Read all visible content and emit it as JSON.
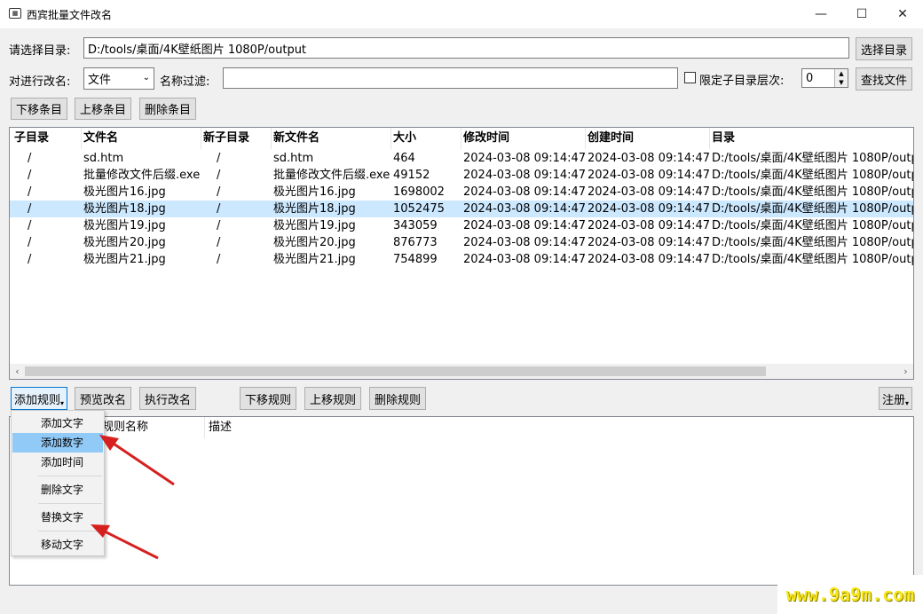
{
  "window": {
    "title": "西宾批量文件改名",
    "icon_name": "app-icon",
    "minimize": "—",
    "maximize": "☐",
    "close": "✕"
  },
  "directory": {
    "label": "请选择目录:",
    "value": "D:/tools/桌面/4K壁纸图片 1080P/output",
    "choose_button": "选择目录"
  },
  "filter": {
    "rename_target_label": "对进行改名:",
    "rename_target_value": "文件",
    "name_filter_label": "名称过滤:",
    "name_filter_value": "",
    "limit_depth_label": "限定子目录层次:",
    "limit_depth_checked": false,
    "depth_value": "0",
    "find_button": "查找文件"
  },
  "item_buttons": {
    "move_down": "下移条目",
    "move_up": "上移条目",
    "delete": "删除条目"
  },
  "file_table": {
    "columns": [
      "子目录",
      "文件名",
      "新子目录",
      "新文件名",
      "大小",
      "修改时间",
      "创建时间",
      "目录"
    ],
    "rows": [
      [
        "/",
        "sd.htm",
        "/",
        "sd.htm",
        "464",
        "2024-03-08 09:14:47",
        "2024-03-08 09:14:47",
        "D:/tools/桌面/4K壁纸图片 1080P/output"
      ],
      [
        "/",
        "批量修改文件后缀.exe",
        "/",
        "批量修改文件后缀.exe",
        "49152",
        "2024-03-08 09:14:47",
        "2024-03-08 09:14:47",
        "D:/tools/桌面/4K壁纸图片 1080P/output"
      ],
      [
        "/",
        "极光图片16.jpg",
        "/",
        "极光图片16.jpg",
        "1698002",
        "2024-03-08 09:14:47",
        "2024-03-08 09:14:47",
        "D:/tools/桌面/4K壁纸图片 1080P/output"
      ],
      [
        "/",
        "极光图片18.jpg",
        "/",
        "极光图片18.jpg",
        "1052475",
        "2024-03-08 09:14:47",
        "2024-03-08 09:14:47",
        "D:/tools/桌面/4K壁纸图片 1080P/output"
      ],
      [
        "/",
        "极光图片19.jpg",
        "/",
        "极光图片19.jpg",
        "343059",
        "2024-03-08 09:14:47",
        "2024-03-08 09:14:47",
        "D:/tools/桌面/4K壁纸图片 1080P/output"
      ],
      [
        "/",
        "极光图片20.jpg",
        "/",
        "极光图片20.jpg",
        "876773",
        "2024-03-08 09:14:47",
        "2024-03-08 09:14:47",
        "D:/tools/桌面/4K壁纸图片 1080P/output"
      ],
      [
        "/",
        "极光图片21.jpg",
        "/",
        "极光图片21.jpg",
        "754899",
        "2024-03-08 09:14:47",
        "2024-03-08 09:14:47",
        "D:/tools/桌面/4K壁纸图片 1080P/output"
      ]
    ],
    "selected_row": 3
  },
  "rule_buttons": {
    "add_rule": "添加规则",
    "preview": "预览改名",
    "execute": "执行改名",
    "move_down": "下移规则",
    "move_up": "上移规则",
    "delete": "删除规则",
    "register": "注册"
  },
  "rule_table": {
    "columns": [
      "规则名称",
      "描述"
    ]
  },
  "add_rule_menu": {
    "items": [
      "添加文字",
      "添加数字",
      "添加时间",
      "删除文字",
      "替换文字",
      "移动文字"
    ],
    "highlighted": "添加数字"
  },
  "watermark": "www.9a9m.com",
  "colors": {
    "selection": "#cce8ff",
    "menu_highlight": "#91c9f7",
    "arrow": "#d62020",
    "watermark": "#f6e61a"
  }
}
